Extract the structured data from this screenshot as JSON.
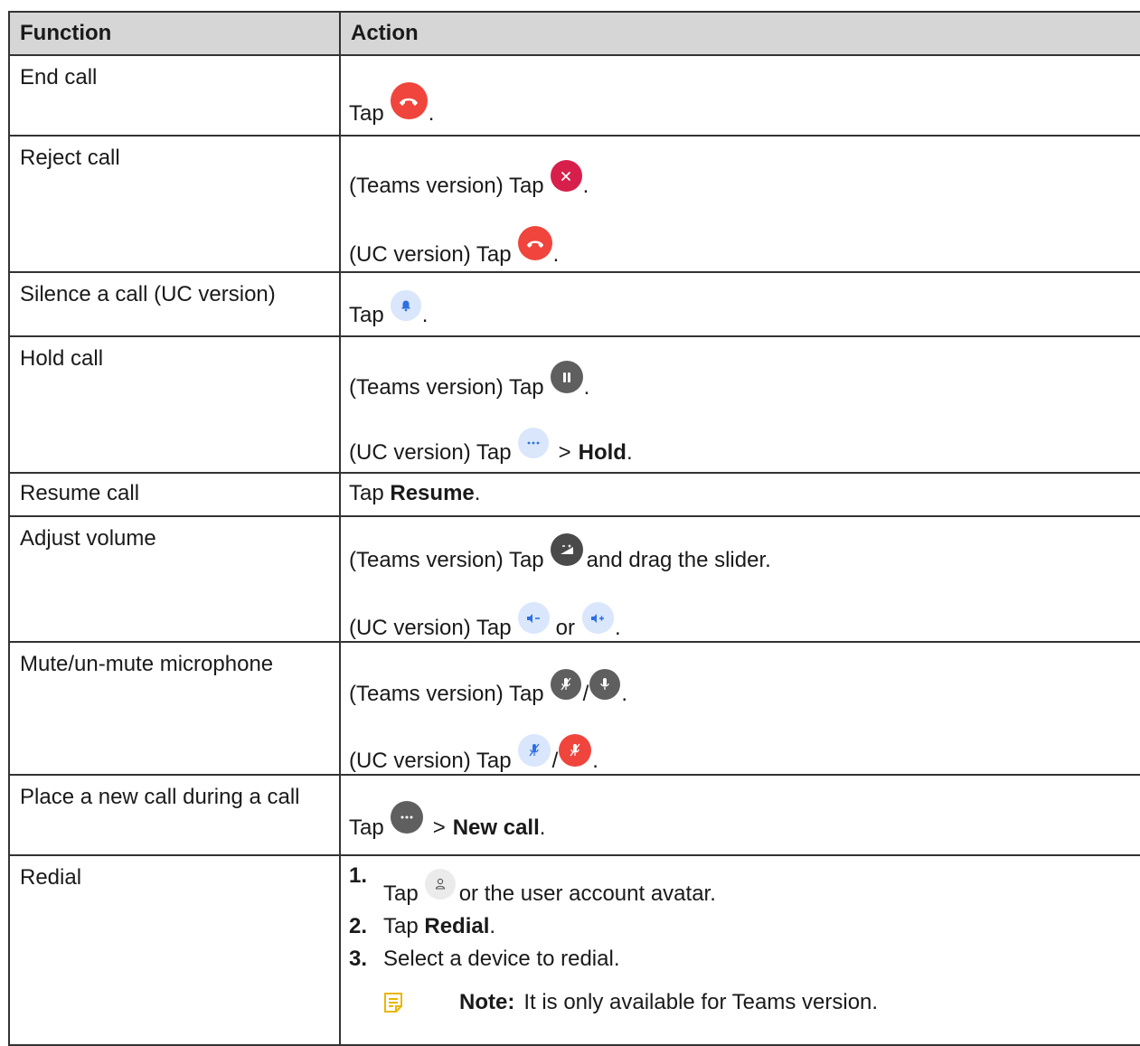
{
  "headers": {
    "function": "Function",
    "action": "Action"
  },
  "rows": {
    "end_call": {
      "function": "End call",
      "tap": "Tap",
      "period": "."
    },
    "reject_call": {
      "function": "Reject call",
      "teams": "(Teams version) Tap",
      "uc": "(UC version) Tap",
      "period": "."
    },
    "silence_call": {
      "function": "Silence a call (UC version)",
      "tap": "Tap",
      "period": "."
    },
    "hold_call": {
      "function": "Hold call",
      "teams": "(Teams version) Tap",
      "uc": "(UC version) Tap",
      "gt": ">",
      "bold": "Hold",
      "period": "."
    },
    "resume_call": {
      "function": "Resume call",
      "tap": "Tap",
      "bold": "Resume",
      "period": "."
    },
    "adjust_volume": {
      "function": "Adjust volume",
      "teams": "(Teams version) Tap",
      "teams_after": "and drag the slider.",
      "uc": "(UC version) Tap",
      "or": "or",
      "period": "."
    },
    "mute_mic": {
      "function": "Mute/un-mute microphone",
      "teams": "(Teams version) Tap",
      "uc": "(UC version) Tap",
      "slash": "/",
      "period": "."
    },
    "new_call": {
      "function": "Place a new call during a call",
      "tap": "Tap",
      "gt": ">",
      "bold": "New call",
      "period": "."
    },
    "redial": {
      "function": "Redial",
      "step1_num": "1.",
      "step1_tap": "Tap",
      "step1_after": "or the user account avatar.",
      "step2_num": "2.",
      "step2_tap": "Tap",
      "step2_bold": "Redial",
      "step2_period": ".",
      "step3_num": "3.",
      "step3_text": "Select a device to redial.",
      "note_label": "Note:",
      "note_text": "It is only available for Teams version."
    }
  },
  "icons": {
    "end_call": "end-call-icon",
    "reject": "reject-x-icon",
    "silence": "bell-icon",
    "hold": "pause-icon",
    "more": "more-icon",
    "volume": "volume-icon",
    "vol_down": "volume-down-icon",
    "vol_up": "volume-up-icon",
    "mic_muted": "mic-muted-icon",
    "mic": "mic-icon",
    "avatar": "user-icon",
    "note": "note-icon"
  },
  "colors": {
    "header_bg": "#d6d6d6",
    "red": "#f0453c",
    "crimson": "#d81f4b",
    "dark_grey": "#5f5f5f",
    "light_blue": "#d9e6fb",
    "blue_glyph": "#2f6fe0",
    "note_yellow": "#e8b600"
  }
}
